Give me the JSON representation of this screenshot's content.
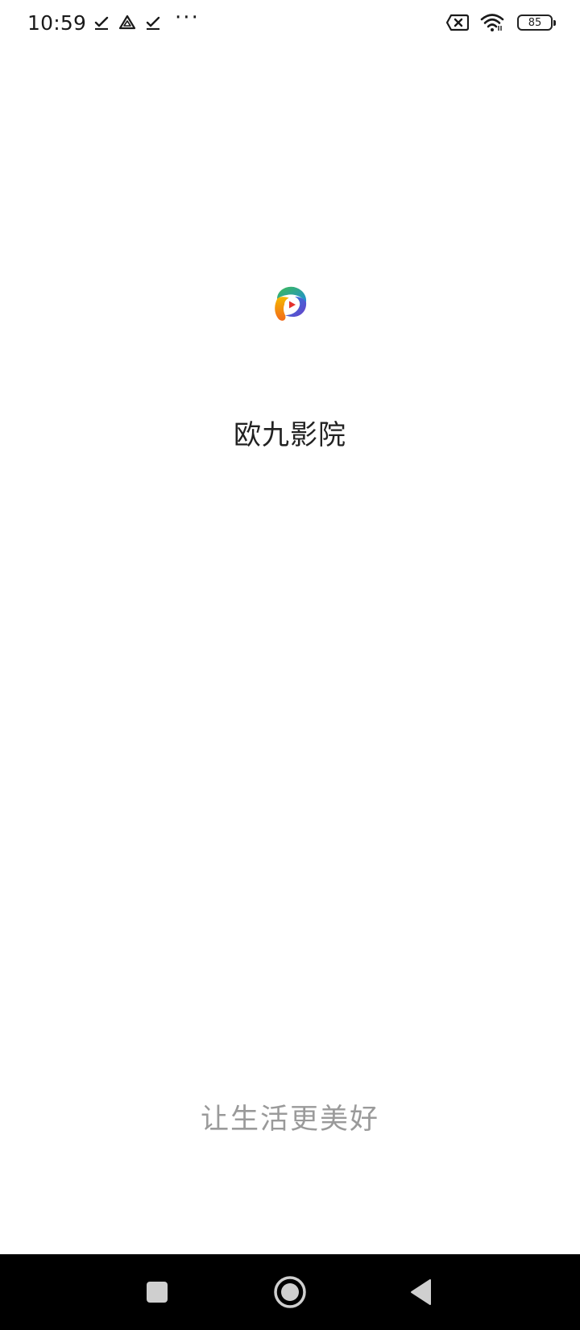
{
  "status_bar": {
    "time": "10:59",
    "left_icons": [
      "download-check-icon",
      "drive-icon",
      "download-check-icon",
      "more-dots-icon"
    ],
    "more": "···",
    "right_icons": [
      "no-sim-icon",
      "wifi-icon",
      "battery-icon"
    ],
    "battery_level": "85"
  },
  "splash": {
    "app_name": "欧九影院",
    "slogan": "让生活更美好",
    "logo_icon": "app-logo-icon",
    "title_color": "#222222",
    "slogan_color": "#9a9a9a"
  },
  "nav_bar": {
    "buttons": [
      "recent-apps-button",
      "home-button",
      "back-button"
    ],
    "background": "#000000",
    "icon_color": "#cfcfcf"
  }
}
